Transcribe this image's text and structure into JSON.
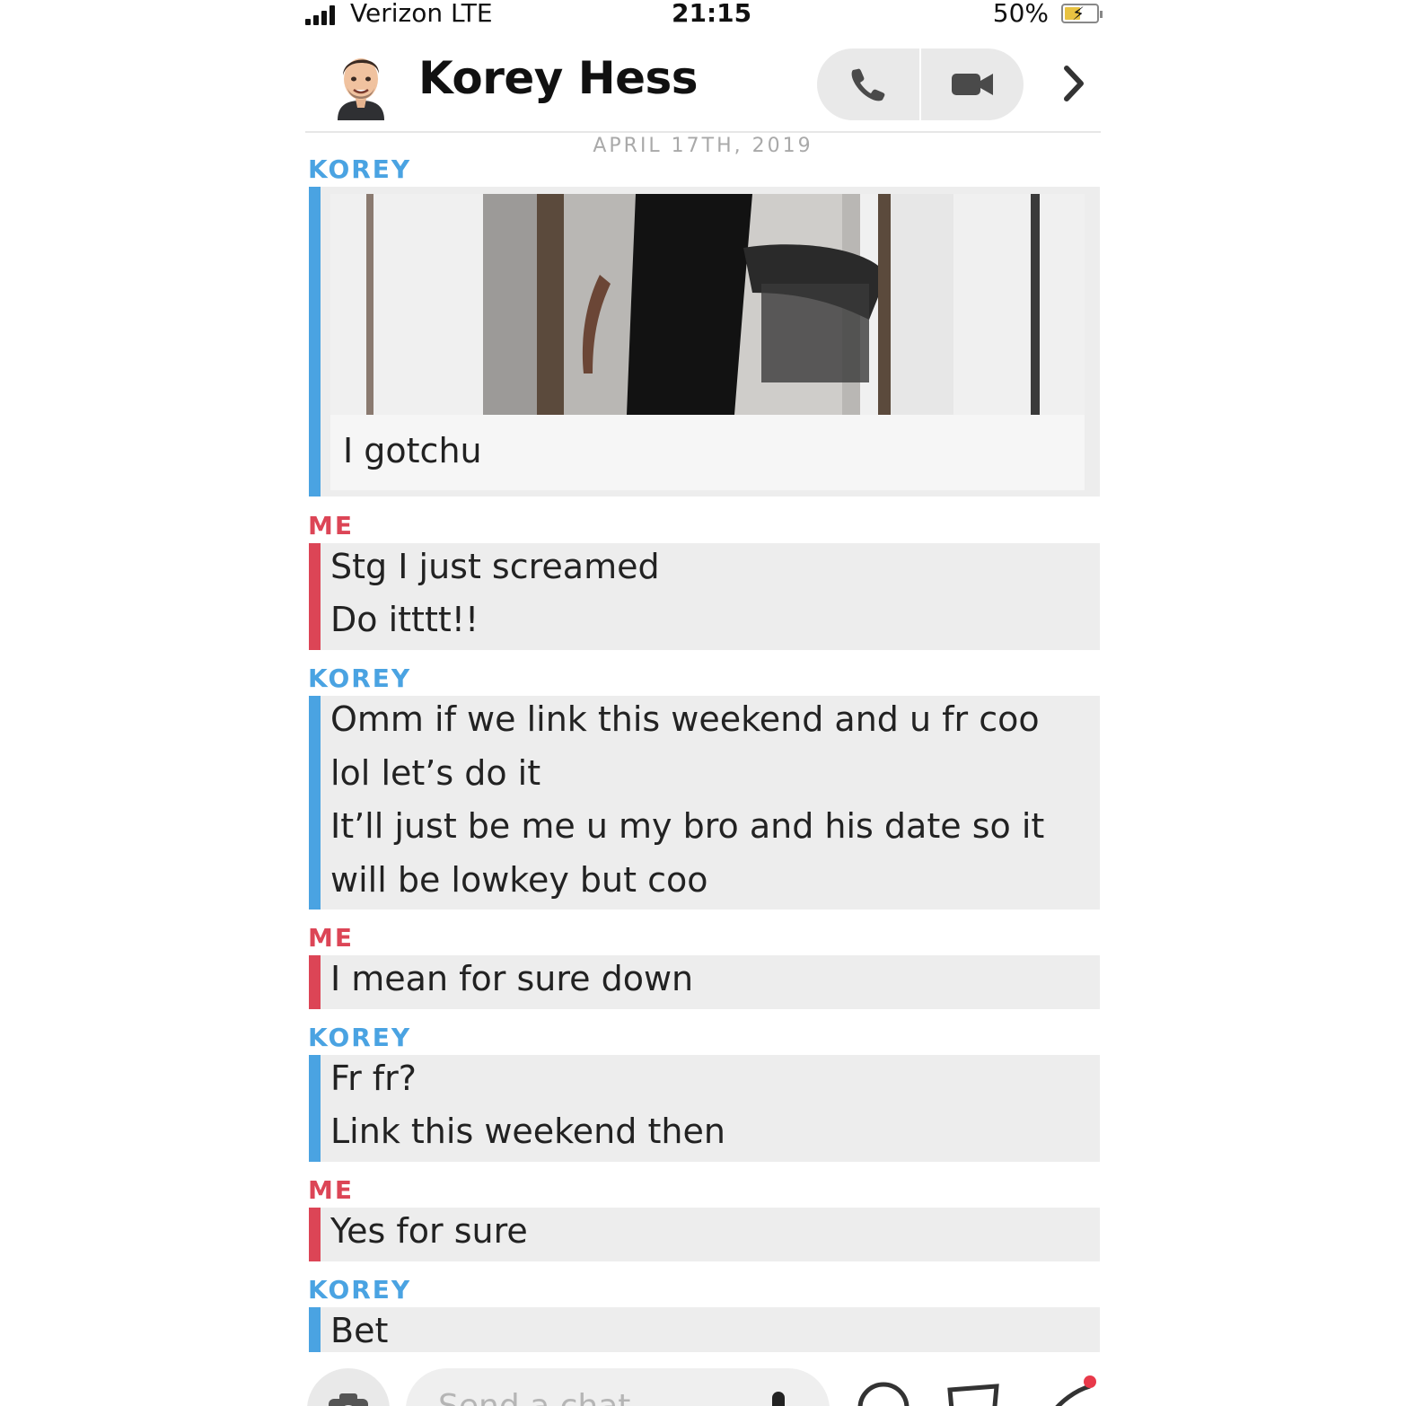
{
  "status_bar": {
    "carrier": "Verizon  LTE",
    "time": "21:15",
    "battery_percent": "50%",
    "battery_level": 0.5
  },
  "header": {
    "contact_name": "Korey Hess",
    "icons": [
      "bitmoji-avatar",
      "phone-icon",
      "video-camera-icon",
      "chevron-right-icon"
    ]
  },
  "date_separator": "APRIL 17TH, 2019",
  "messages": [
    {
      "sender": "KOREY",
      "media_caption": "I gotchu"
    },
    {
      "sender": "ME",
      "lines": [
        "Stg I just screamed",
        "Do itttt!!"
      ]
    },
    {
      "sender": "KOREY",
      "lines": [
        "Omm if we link this weekend and u fr coo",
        "lol let’s do it",
        "It’ll just be me u my bro and his date so it",
        "will be lowkey but coo"
      ]
    },
    {
      "sender": "ME",
      "lines": [
        "I mean for sure down"
      ]
    },
    {
      "sender": "KOREY",
      "lines": [
        "Fr fr?",
        "Link this weekend then"
      ]
    },
    {
      "sender": "ME",
      "lines": [
        "Yes for sure"
      ]
    },
    {
      "sender": "KOREY",
      "lines": [
        "Bet"
      ]
    }
  ],
  "composer": {
    "placeholder": "Send a chat",
    "icons": [
      "camera-icon",
      "microphone-icon",
      "smiley-icon",
      "stickers-icon",
      "rocket-icon"
    ]
  },
  "colors": {
    "korey_accent": "#4aa3e2",
    "me_accent": "#dc4556",
    "bubble_bg": "#ededed",
    "notification_dot": "#e8394a"
  }
}
